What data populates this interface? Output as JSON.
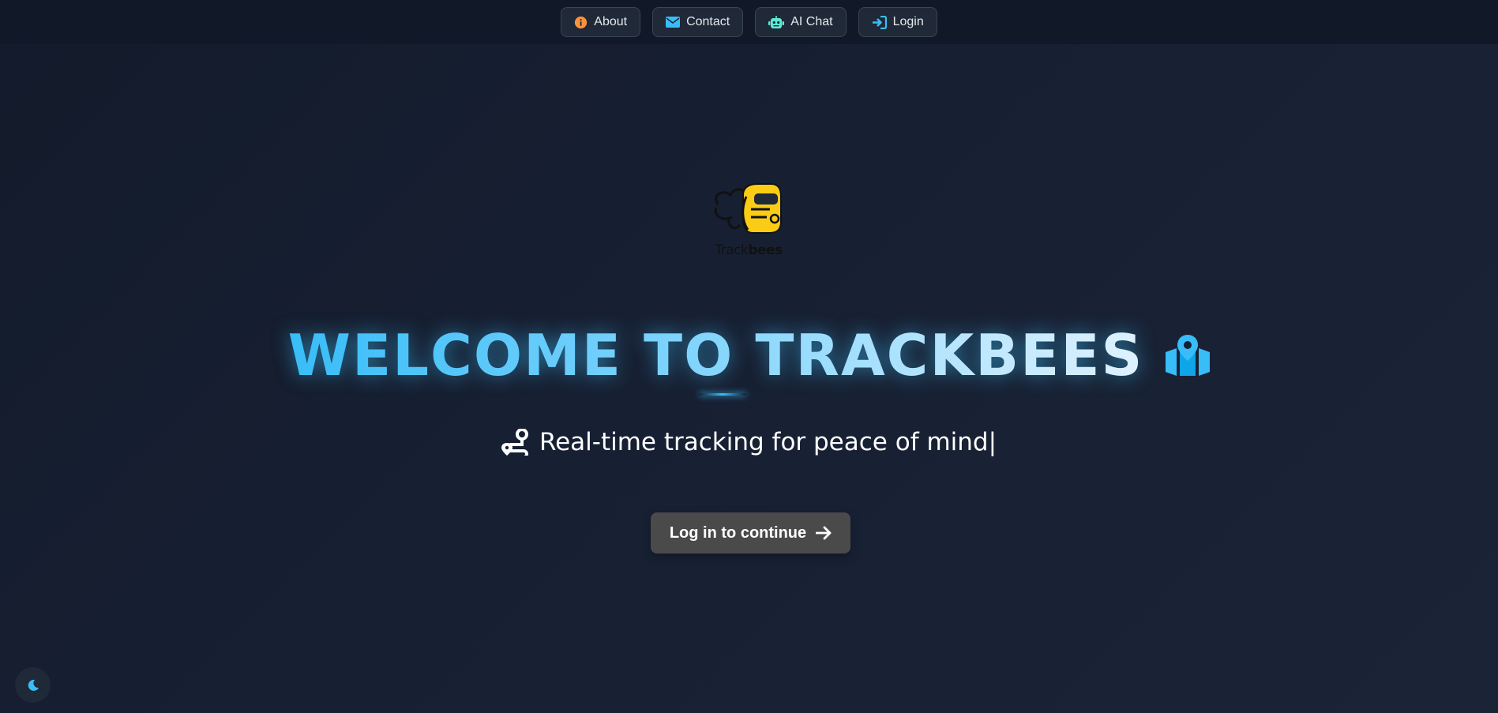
{
  "nav": {
    "items": [
      {
        "label": "About",
        "icon": "info-icon",
        "color": "#fb923c"
      },
      {
        "label": "Contact",
        "icon": "envelope-icon",
        "color": "#38bdf8"
      },
      {
        "label": "AI Chat",
        "icon": "robot-icon",
        "color": "#5eead4"
      },
      {
        "label": "Login",
        "icon": "login-icon",
        "color": "#38bdf8"
      }
    ]
  },
  "logo": {
    "text_track": "Track",
    "text_bees": "bees",
    "colors": {
      "body": "#facc15",
      "outline": "#111111"
    }
  },
  "hero": {
    "title": "WELCOME TO TRACKBEES",
    "title_icon": "map-location-icon",
    "tagline": "Real-time tracking for peace of mind|",
    "tagline_icon": "route-icon",
    "accent": "#38bdf8"
  },
  "cta": {
    "label": "Log in to continue",
    "icon": "arrow-right-icon"
  },
  "theme_toggle": {
    "icon": "moon-icon",
    "color": "#38bdf8"
  }
}
